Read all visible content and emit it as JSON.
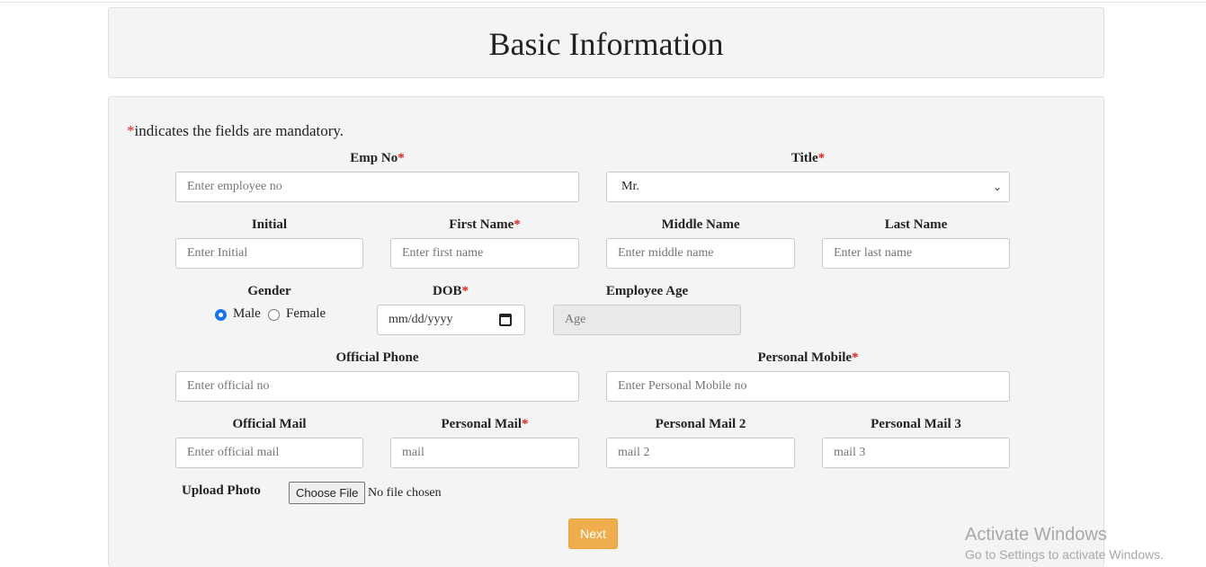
{
  "header": {
    "title": "Basic Information"
  },
  "note": {
    "asterisk": "*",
    "text": "indicates the fields are mandatory."
  },
  "fields": {
    "emp_no": {
      "label": "Emp No",
      "placeholder": "Enter employee no"
    },
    "title": {
      "label": "Title",
      "value": "Mr."
    },
    "initial": {
      "label": "Initial",
      "placeholder": "Enter Initial"
    },
    "first_name": {
      "label": "First Name",
      "placeholder": "Enter first name"
    },
    "middle_name": {
      "label": "Middle Name",
      "placeholder": "Enter middle name"
    },
    "last_name": {
      "label": "Last Name",
      "placeholder": "Enter last name"
    },
    "gender": {
      "label": "Gender",
      "options": [
        "Male",
        "Female"
      ],
      "selected": "Male"
    },
    "dob": {
      "label": "DOB",
      "placeholder": "mm/dd/yyyy"
    },
    "employee_age": {
      "label": "Employee Age",
      "placeholder": "Age"
    },
    "official_phone": {
      "label": "Official Phone",
      "placeholder": "Enter official no"
    },
    "personal_mobile": {
      "label": "Personal Mobile",
      "placeholder": "Enter Personal Mobile no"
    },
    "official_mail": {
      "label": "Official Mail",
      "placeholder": "Enter official mail"
    },
    "personal_mail": {
      "label": "Personal Mail",
      "placeholder": "mail"
    },
    "personal_mail_2": {
      "label": "Personal Mail 2",
      "placeholder": "mail 2"
    },
    "personal_mail_3": {
      "label": "Personal Mail 3",
      "placeholder": "mail 3"
    },
    "upload_photo": {
      "label": "Upload Photo",
      "button": "Choose File",
      "status": "No file chosen"
    }
  },
  "required_mark": "*",
  "actions": {
    "next": "Next"
  },
  "watermark": {
    "line1": "Activate Windows",
    "line2": "Go to Settings to activate Windows."
  },
  "colors": {
    "required": "#d9231f",
    "next_button": "#f0ad4e",
    "radio_checked": "#1a73e8"
  }
}
